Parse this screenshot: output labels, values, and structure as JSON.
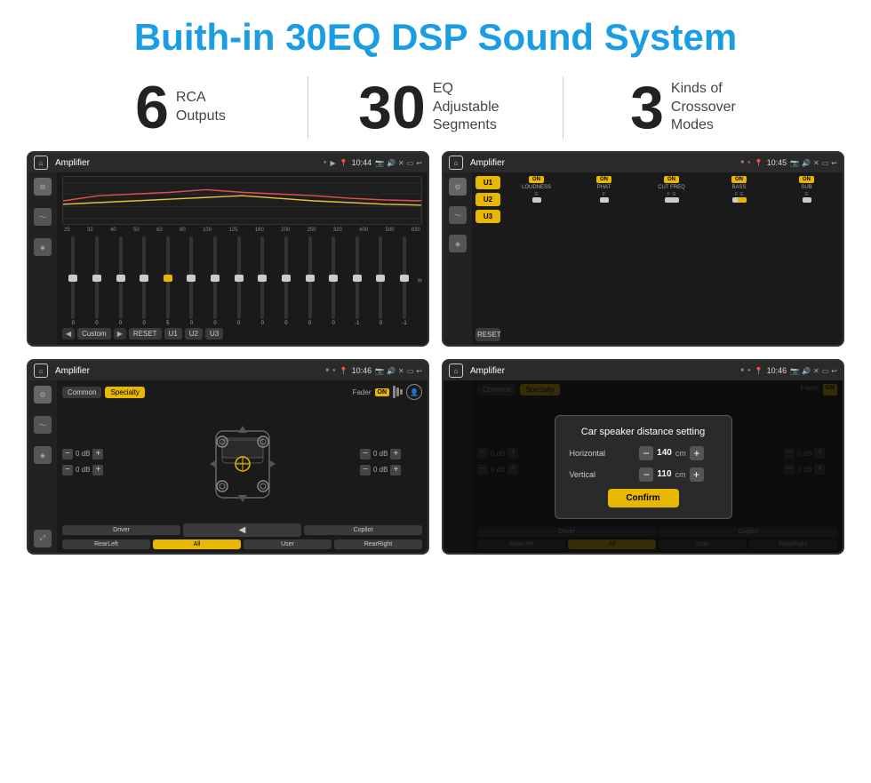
{
  "page": {
    "title": "Buith-in 30EQ DSP Sound System",
    "stats": [
      {
        "number": "6",
        "label": "RCA\nOutputs"
      },
      {
        "number": "30",
        "label": "EQ Adjustable\nSegments"
      },
      {
        "number": "3",
        "label": "Kinds of\nCrossover Modes"
      }
    ]
  },
  "screen1": {
    "status_bar": {
      "title": "Amplifier",
      "time": "10:44"
    },
    "eq_freqs": [
      "25",
      "32",
      "40",
      "50",
      "63",
      "80",
      "100",
      "125",
      "160",
      "200",
      "250",
      "320",
      "400",
      "500",
      "630"
    ],
    "eq_values": [
      "0",
      "0",
      "0",
      "0",
      "5",
      "0",
      "0",
      "0",
      "0",
      "0",
      "0",
      "0",
      "-1",
      "0",
      "-1"
    ],
    "bottom_buttons": [
      "Custom",
      "RESET",
      "U1",
      "U2",
      "U3"
    ]
  },
  "screen2": {
    "status_bar": {
      "title": "Amplifier",
      "time": "10:45"
    },
    "presets": [
      "U1",
      "U2",
      "U3"
    ],
    "controls": [
      "LOUDNESS",
      "PHAT",
      "CUT FREQ",
      "BASS",
      "SUB"
    ],
    "on_labels": [
      "ON",
      "ON",
      "ON",
      "ON",
      "ON"
    ],
    "reset_label": "RESET"
  },
  "screen3": {
    "status_bar": {
      "title": "Amplifier",
      "time": "10:46"
    },
    "tabs": [
      "Common",
      "Specialty"
    ],
    "fader_label": "Fader",
    "on_label": "ON",
    "channels": {
      "left_top": "0 dB",
      "left_bottom": "0 dB",
      "right_top": "0 dB",
      "right_bottom": "0 dB"
    },
    "bottom_buttons": [
      "Driver",
      "",
      "Copilot",
      "RearLeft",
      "All",
      "User",
      "RearRight"
    ]
  },
  "screen4": {
    "status_bar": {
      "title": "Amplifier",
      "time": "10:46"
    },
    "dialog": {
      "title": "Car speaker distance setting",
      "horizontal_label": "Horizontal",
      "horizontal_value": "140",
      "horizontal_unit": "cm",
      "vertical_label": "Vertical",
      "vertical_value": "110",
      "vertical_unit": "cm",
      "confirm_label": "Confirm"
    },
    "tabs": [
      "Common",
      "Specialty"
    ],
    "bottom_buttons": [
      "Driver",
      "Copilot",
      "RearLeft",
      "All",
      "User",
      "RearRight"
    ]
  }
}
